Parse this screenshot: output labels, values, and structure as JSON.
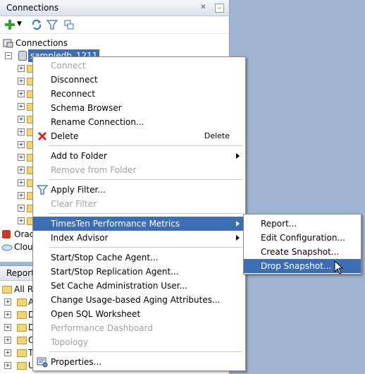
{
  "connections_panel": {
    "title": "Connections",
    "root_label": "Connections",
    "selected_connection": "sampledb_1211",
    "partial_items": [
      "Orac",
      "Cloud"
    ]
  },
  "reports_panel": {
    "title": "Reports",
    "root_label": "All Re",
    "partial_items": [
      "A",
      "D",
      "D",
      "O",
      "T",
      "U"
    ]
  },
  "context_menu": {
    "items": [
      {
        "label": "Connect",
        "enabled": false
      },
      {
        "label": "Disconnect",
        "enabled": true
      },
      {
        "label": "Reconnect",
        "enabled": true
      },
      {
        "label": "Schema Browser",
        "enabled": true
      },
      {
        "label": "Rename Connection...",
        "enabled": true
      },
      {
        "label": "Delete",
        "enabled": true,
        "shortcut": "Delete",
        "icon": "delete-x-icon"
      },
      {
        "label": "Add to Folder",
        "enabled": true,
        "submenu": true
      },
      {
        "label": "Remove from Folder",
        "enabled": false
      },
      {
        "label": "Apply Filter...",
        "enabled": true,
        "icon": "filter-icon"
      },
      {
        "label": "Clear Filter",
        "enabled": false
      },
      {
        "label": "TimesTen Performance Metrics",
        "enabled": true,
        "submenu": true,
        "highlighted": true
      },
      {
        "label": "Index Advisor",
        "enabled": true,
        "submenu": true
      },
      {
        "label": "Start/Stop Cache Agent...",
        "enabled": true
      },
      {
        "label": "Start/Stop Replication Agent...",
        "enabled": true
      },
      {
        "label": "Set Cache Administration User...",
        "enabled": true
      },
      {
        "label": "Change Usage-based Aging Attributes...",
        "enabled": true
      },
      {
        "label": "Open SQL Worksheet",
        "enabled": true
      },
      {
        "label": "Performance Dashboard",
        "enabled": false
      },
      {
        "label": "Topology",
        "enabled": false
      },
      {
        "label": "Properties...",
        "enabled": true,
        "icon": "properties-icon"
      }
    ]
  },
  "submenu": {
    "items": [
      {
        "label": "Report..."
      },
      {
        "label": "Edit Configuration..."
      },
      {
        "label": "Create Snapshot..."
      },
      {
        "label": "Drop Snapshot...",
        "highlighted": true
      }
    ]
  },
  "colors": {
    "highlight": "#3d6eb3",
    "disabled_text": "#a0a0a0",
    "desktop": "#9fb5d1"
  }
}
